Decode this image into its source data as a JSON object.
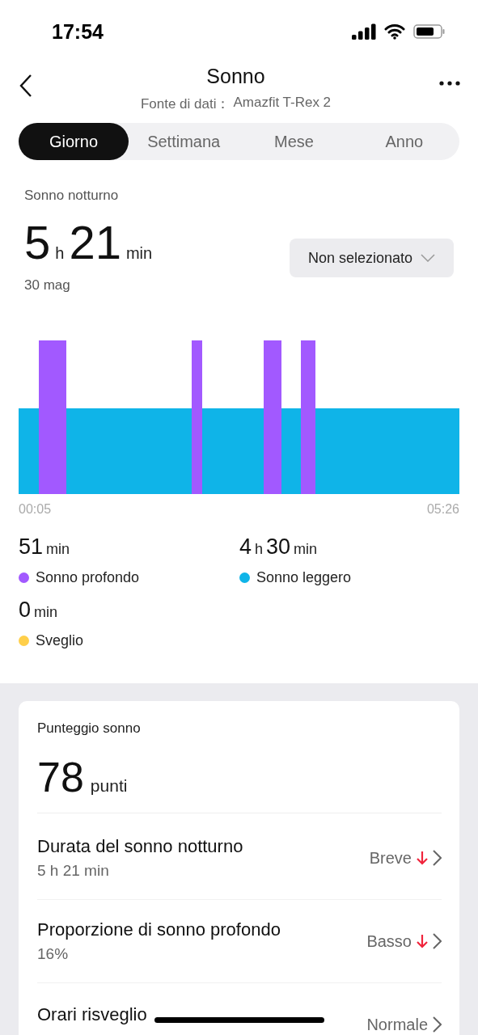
{
  "status_bar": {
    "time": "17:54"
  },
  "header": {
    "title": "Sonno",
    "source_label": "Fonte di dati：",
    "source_value": "Amazfit T-Rex 2"
  },
  "tabs": [
    {
      "label": "Giorno",
      "selected": true
    },
    {
      "label": "Settimana",
      "selected": false
    },
    {
      "label": "Mese",
      "selected": false
    },
    {
      "label": "Anno",
      "selected": false
    }
  ],
  "summary": {
    "label": "Sonno notturno",
    "hours": "5",
    "hours_unit": "h",
    "minutes": "21",
    "minutes_unit": "min",
    "date": "30 mag",
    "filter": "Non selezionato"
  },
  "chart": {
    "start": "00:05",
    "end": "05:26"
  },
  "legend": [
    {
      "value": "51",
      "unit": "min",
      "label": "Sonno profondo",
      "color": "#a259ff"
    },
    {
      "value_h": "4",
      "unit_h": "h",
      "value": "30",
      "unit": "min",
      "label": "Sonno leggero",
      "color": "#0fb4e8"
    },
    {
      "value": "0",
      "unit": "min",
      "label": "Sveglio",
      "color": "#ffcf4a"
    }
  ],
  "score": {
    "title": "Punteggio sonno",
    "value": "78",
    "unit": "punti",
    "rows": [
      {
        "title": "Durata del sonno notturno",
        "detail": "5 h 21 min",
        "rating": "Breve",
        "down": true
      },
      {
        "title": "Proporzione di sonno profondo",
        "detail": "16%",
        "rating": "Basso",
        "down": true
      },
      {
        "title": "Orari risveglio",
        "rating": "Normale",
        "down": false
      }
    ]
  }
}
